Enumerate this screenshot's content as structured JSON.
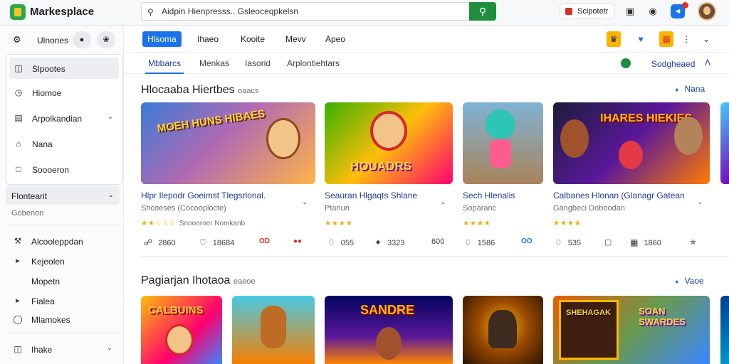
{
  "app": {
    "title": "Markesplace"
  },
  "search": {
    "value": "Aidpin Hienpresss.. Gsleoceqpkelsn",
    "placeholder": ""
  },
  "topbar": {
    "sponsor_label": "Scipotetr"
  },
  "sidebar": {
    "header_label": "Ulnones",
    "items": [
      {
        "label": "Slpootes",
        "icon": "grid-icon",
        "active": true
      },
      {
        "label": "Hiomoe",
        "icon": "clock-icon",
        "active": false
      },
      {
        "label": "Arpolkandian",
        "icon": "cart-icon",
        "active": false,
        "has_chevron": true
      },
      {
        "label": "Nana",
        "icon": "home-icon",
        "active": false
      },
      {
        "label": "Soooeron",
        "icon": "box-icon",
        "active": false
      }
    ],
    "section1": {
      "title": "Flontearit",
      "sub": "Gobenon"
    },
    "section1_items": [
      {
        "label": "Alcooleppdan",
        "icon": "wrench-icon"
      },
      {
        "label": "Kejeolen",
        "icon": "triangle-icon"
      },
      {
        "label": "Mopetn",
        "icon": ""
      },
      {
        "label": "Fialea",
        "icon": "triangle-icon"
      },
      {
        "label": "Mlamokes",
        "icon": "circle-icon"
      }
    ],
    "section2": {
      "title": "Ihake"
    }
  },
  "tabs": [
    {
      "label": "Hlsoma",
      "active": true
    },
    {
      "label": "Ihaeo",
      "active": false
    },
    {
      "label": "Kooite",
      "active": false
    },
    {
      "label": "Mevv",
      "active": false
    },
    {
      "label": "Apeo",
      "active": false
    }
  ],
  "subtabs": [
    {
      "label": "Mbbarcs",
      "active": true
    },
    {
      "label": "Menkas",
      "active": false
    },
    {
      "label": "Iasorid",
      "active": false
    },
    {
      "label": "Arplontiehtars",
      "active": false
    }
  ],
  "subtab_right": "Sodgheaed",
  "sections": [
    {
      "title": "Hlocaaba Hiertbes",
      "title_small": "oaacs",
      "see_all": "Nana"
    },
    {
      "title": "Pagiarjan Ihotaoa",
      "title_small": "eaeoe",
      "see_all": "Vaoe"
    }
  ],
  "cards": [
    {
      "art": "MOEH HUNS HIBAES",
      "title": "Hlpr Ilepodr Goeimst Tlegsrlonal.",
      "sub": "Shcoeses (Cocooplocte)",
      "rating_text": "Snoooroer Nomkanb",
      "stars": 2,
      "stats": [
        "2860",
        "18684",
        "OD"
      ]
    },
    {
      "art": "HOUADRS",
      "title": "Seauran Hlgaqts Shlane",
      "sub": "Ptanun",
      "rating_text": "",
      "stars": 4,
      "stats": [
        "055",
        "3323",
        "600"
      ]
    },
    {
      "art": "",
      "title": "Sech Hlenalis",
      "sub": "Soparanc",
      "rating_text": "",
      "stars": 4,
      "stats": [
        "1586",
        "OO"
      ]
    },
    {
      "art": "IHARES HIEKIES",
      "title": "Calbanes Hlonan (Glanagr Gatean",
      "sub": "Gangbeci Doboodan",
      "rating_text": "",
      "stars": 4,
      "stats": [
        "535",
        "",
        "1860",
        ""
      ]
    }
  ],
  "row2": [
    {
      "art": "CALBUINS"
    },
    {
      "art": ""
    },
    {
      "art": "SANDRE"
    },
    {
      "art": ""
    },
    {
      "art": "SOAN SWARDES"
    }
  ],
  "colors": {
    "accent": "#1a73e8",
    "brand_green": "#1e8e3e",
    "link": "#1b3a8c",
    "star": "#f2a900",
    "alert_red": "#d93025"
  }
}
